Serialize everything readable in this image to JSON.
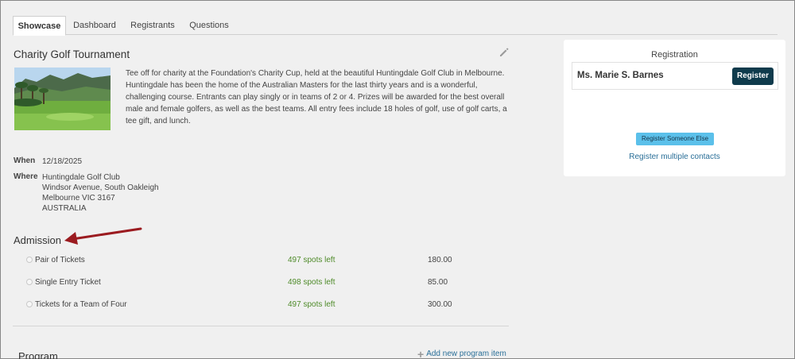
{
  "tabs": [
    {
      "label": "Showcase",
      "active": true
    },
    {
      "label": "Dashboard",
      "active": false
    },
    {
      "label": "Registrants",
      "active": false
    },
    {
      "label": "Questions",
      "active": false
    }
  ],
  "event": {
    "title": "Charity Golf Tournament",
    "description": "Tee off for charity at the Foundation's Charity Cup, held at the beautiful Huntingdale Golf Club in Melbourne. Huntingdale has been the home of the Australian Masters for the last thirty years and is a wonderful, challenging course. Entrants can play singly or in teams of 2 or 4. Prizes will be awarded for the best overall male and female golfers, as well as the best teams. All entry fees include 18 holes of golf, use of golf carts, a tee gift, and lunch.",
    "when_label": "When",
    "when_value": "12/18/2025",
    "where_label": "Where",
    "where_lines": [
      "Huntingdale Golf Club",
      "Windsor Avenue, South Oakleigh",
      "Melbourne VIC 3167",
      "AUSTRALIA"
    ]
  },
  "admission": {
    "title": "Admission",
    "tickets": [
      {
        "name": "Pair of Tickets",
        "spots": "497 spots left",
        "price": "180.00"
      },
      {
        "name": "Single Entry Ticket",
        "spots": "498 spots left",
        "price": "85.00"
      },
      {
        "name": "Tickets for a Team of Four",
        "spots": "497 spots left",
        "price": "300.00"
      }
    ]
  },
  "program": {
    "title": "Program",
    "add_label": "Add new program item"
  },
  "registration": {
    "heading": "Registration",
    "contact_name": "Ms. Marie S. Barnes",
    "register_label": "Register",
    "register_else_label": "Register Someone Else",
    "register_multiple_label": "Register multiple contacts"
  },
  "colors": {
    "register_button": "#0f3b4c",
    "register_else_button": "#5bc0ea",
    "spots_text": "#4f8b2a",
    "link": "#2a6f98",
    "annotation_arrow": "#9b1b20"
  }
}
